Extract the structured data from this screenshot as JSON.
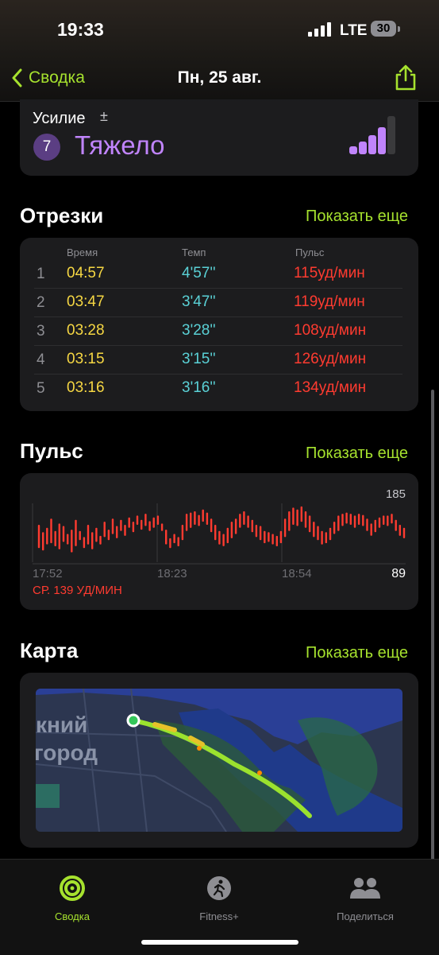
{
  "status": {
    "time": "19:33",
    "network": "LTE",
    "battery": "30"
  },
  "nav": {
    "back_label": "Сводка",
    "title": "Пн, 25 авг."
  },
  "effort": {
    "label": "Усилие",
    "pm": "±",
    "level": "7",
    "value": "Тяжело",
    "color": "#c084fc"
  },
  "splits": {
    "title": "Отрезки",
    "more": "Показать еще",
    "columns": [
      "Время",
      "Темп",
      "Пульс"
    ],
    "rows": [
      {
        "idx": "1",
        "time": "04:57",
        "pace": "4'57''",
        "hr": "115уд/мин"
      },
      {
        "idx": "2",
        "time": "03:47",
        "pace": "3'47''",
        "hr": "119уд/мин"
      },
      {
        "idx": "3",
        "time": "03:28",
        "pace": "3'28''",
        "hr": "108уд/мин"
      },
      {
        "idx": "4",
        "time": "03:15",
        "pace": "3'15''",
        "hr": "126уд/мин"
      },
      {
        "idx": "5",
        "time": "03:16",
        "pace": "3'16''",
        "hr": "134уд/мин"
      }
    ]
  },
  "pulse": {
    "title": "Пульс",
    "more": "Показать еще",
    "max_label": "185",
    "min_label": "89",
    "average": "СР. 139 УД/МИН",
    "time_labels": [
      "17:52",
      "18:23",
      "18:54"
    ]
  },
  "map": {
    "title": "Карта",
    "more": "Показать еще",
    "label_line1": "кний",
    "label_line2": "город"
  },
  "tabs": [
    {
      "label": "Сводка",
      "icon": "activity-rings-icon"
    },
    {
      "label": "Fitness+",
      "icon": "fitness-runner-icon"
    },
    {
      "label": "Поделиться",
      "icon": "sharing-people-icon"
    }
  ],
  "colors": {
    "accent": "#a6e22e",
    "time": "#f6d743",
    "pace": "#5ad1d6",
    "heart": "#ff3b30",
    "effort": "#c084fc"
  },
  "chart_data": {
    "type": "bar",
    "title": "Пульс",
    "xlabel": "",
    "ylabel": "",
    "x_tick_labels": [
      "17:52",
      "18:23",
      "18:54"
    ],
    "ylim": [
      89,
      185
    ],
    "average": 139,
    "series": [
      {
        "values": [
          [
            112,
            150
          ],
          [
            108,
            138
          ],
          [
            118,
            145
          ],
          [
            120,
            160
          ],
          [
            115,
            140
          ],
          [
            110,
            152
          ],
          [
            122,
            148
          ],
          [
            118,
            135
          ],
          [
            105,
            142
          ],
          [
            115,
            158
          ],
          [
            125,
            140
          ],
          [
            112,
            130
          ],
          [
            118,
            150
          ],
          [
            110,
            138
          ],
          [
            122,
            145
          ],
          [
            118,
            132
          ],
          [
            130,
            155
          ],
          [
            125,
            142
          ],
          [
            135,
            160
          ],
          [
            128,
            148
          ],
          [
            140,
            158
          ],
          [
            132,
            150
          ],
          [
            145,
            162
          ],
          [
            138,
            155
          ],
          [
            150,
            165
          ],
          [
            142,
            158
          ],
          [
            148,
            168
          ],
          [
            140,
            156
          ],
          [
            145,
            162
          ],
          [
            150,
            165
          ],
          [
            140,
            152
          ],
          [
            118,
            142
          ],
          [
            112,
            128
          ],
          [
            120,
            135
          ],
          [
            115,
            130
          ],
          [
            125,
            150
          ],
          [
            140,
            168
          ],
          [
            145,
            170
          ],
          [
            150,
            172
          ],
          [
            148,
            166
          ],
          [
            155,
            175
          ],
          [
            150,
            170
          ],
          [
            138,
            160
          ],
          [
            125,
            150
          ],
          [
            118,
            140
          ],
          [
            115,
            135
          ],
          [
            120,
            145
          ],
          [
            128,
            155
          ],
          [
            135,
            160
          ],
          [
            145,
            168
          ],
          [
            150,
            172
          ],
          [
            145,
            165
          ],
          [
            138,
            158
          ],
          [
            130,
            150
          ],
          [
            125,
            148
          ],
          [
            120,
            140
          ],
          [
            122,
            138
          ],
          [
            118,
            135
          ],
          [
            115,
            132
          ],
          [
            120,
            140
          ],
          [
            130,
            160
          ],
          [
            140,
            172
          ],
          [
            150,
            178
          ],
          [
            148,
            175
          ],
          [
            155,
            180
          ],
          [
            145,
            172
          ],
          [
            138,
            165
          ],
          [
            130,
            155
          ],
          [
            125,
            148
          ],
          [
            118,
            140
          ],
          [
            120,
            138
          ],
          [
            125,
            145
          ],
          [
            135,
            155
          ],
          [
            140,
            165
          ],
          [
            148,
            168
          ],
          [
            152,
            170
          ],
          [
            150,
            168
          ],
          [
            145,
            165
          ],
          [
            150,
            168
          ],
          [
            148,
            166
          ],
          [
            140,
            160
          ],
          [
            132,
            152
          ],
          [
            138,
            158
          ],
          [
            145,
            162
          ],
          [
            150,
            165
          ],
          [
            148,
            165
          ],
          [
            152,
            168
          ],
          [
            140,
            158
          ],
          [
            132,
            150
          ],
          [
            128,
            145
          ]
        ]
      }
    ]
  }
}
